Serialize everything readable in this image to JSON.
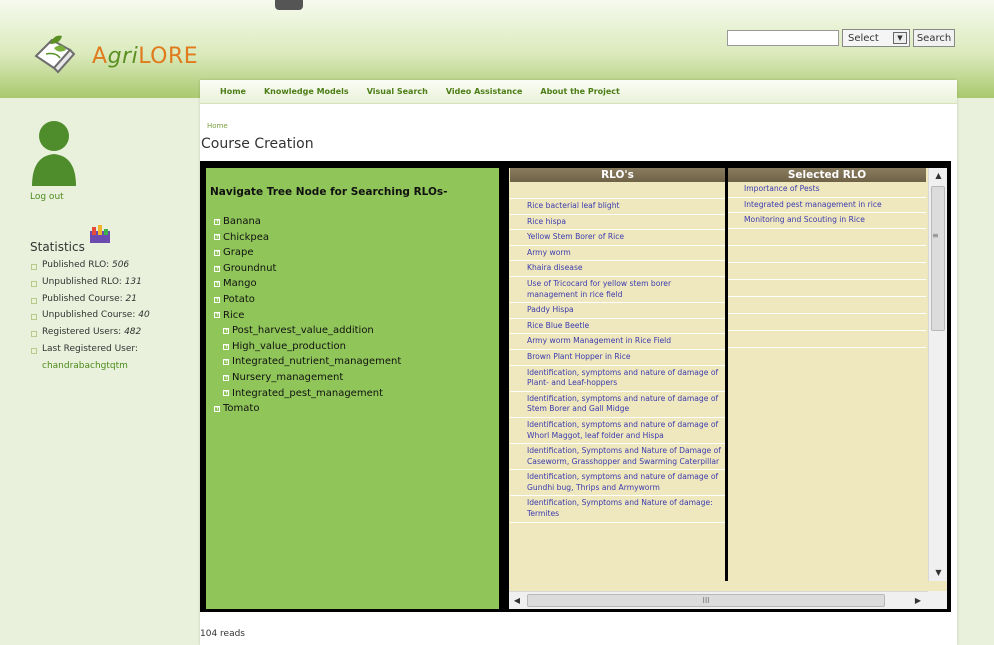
{
  "header": {
    "logo_text_a": "A",
    "logo_text_g": "gri",
    "logo_text_b": "LORE",
    "search_value": "",
    "select_value": "Select",
    "search_button": "Search"
  },
  "nav": {
    "items": [
      "Home",
      "Knowledge Models",
      "Visual Search",
      "Video Assistance",
      "About the Project"
    ]
  },
  "breadcrumb": "Home",
  "page_title": "Course Creation",
  "sidebar": {
    "logout": "Log out",
    "stats_title": "Statistics",
    "stats": [
      {
        "label": "Published RLO: ",
        "value": "506"
      },
      {
        "label": "Unpublished RLO: ",
        "value": "131"
      },
      {
        "label": "Published Course: ",
        "value": "21"
      },
      {
        "label": "Unpublished Course: ",
        "value": "40"
      },
      {
        "label": "Registered Users: ",
        "value": "482"
      },
      {
        "label": "Last Registered User:",
        "value": ""
      }
    ],
    "last_user": "chandrabachgtqtm"
  },
  "tree": {
    "heading": "Navigate Tree Node for Searching RLOs-",
    "nodes": [
      "Banana",
      "Chickpea",
      "Grape",
      "Groundnut",
      "Mango",
      "Potato",
      "Rice"
    ],
    "rice_children": [
      "Post_harvest_value_addition",
      "High_value_production",
      "Integrated_nutrient_management",
      "Nursery_management",
      "Integrated_pest_management"
    ],
    "last_node": "Tomato"
  },
  "grid": {
    "rlo_header": "RLO's",
    "selected_header": "Selected RLO",
    "rlos": [
      "Rice bacterial leaf blight",
      "Rice hispa",
      "Yellow Stem Borer of Rice",
      "Army worm",
      "Khaira disease",
      "Use of Tricocard for yellow stem borer management in rice field",
      "Paddy Hispa",
      "Rice Blue Beetle",
      "Army worm Management in Rice Field",
      "Brown Plant Hopper in Rice",
      "Identification, symptoms and nature of damage of Plant- and Leaf-hoppers",
      "Identification, symptoms and nature of damage of Stem Borer and Gall Midge",
      "Identification, symptoms and nature of damage of Whorl Maggot, leaf folder and Hispa",
      "Identification, Symptoms and Nature of Damage of Caseworm, Grasshopper and Swarming Caterpillar",
      "Identification, symptoms and nature of damage of Gundhi bug, Thrips and Armyworm",
      "Identification, Symptoms and Nature of damage: Termites"
    ],
    "selected": [
      "Importance of Pests",
      "Integrated pest management in rice",
      "Monitoring and Scouting in Rice"
    ],
    "hscroll_grip": "III"
  },
  "footer": {
    "reads": "104 reads"
  },
  "colors": {
    "accent": "#4c7d16",
    "tree_bg": "#90c659",
    "grid_bg": "#efe7bd",
    "link": "#3b3bb0"
  }
}
